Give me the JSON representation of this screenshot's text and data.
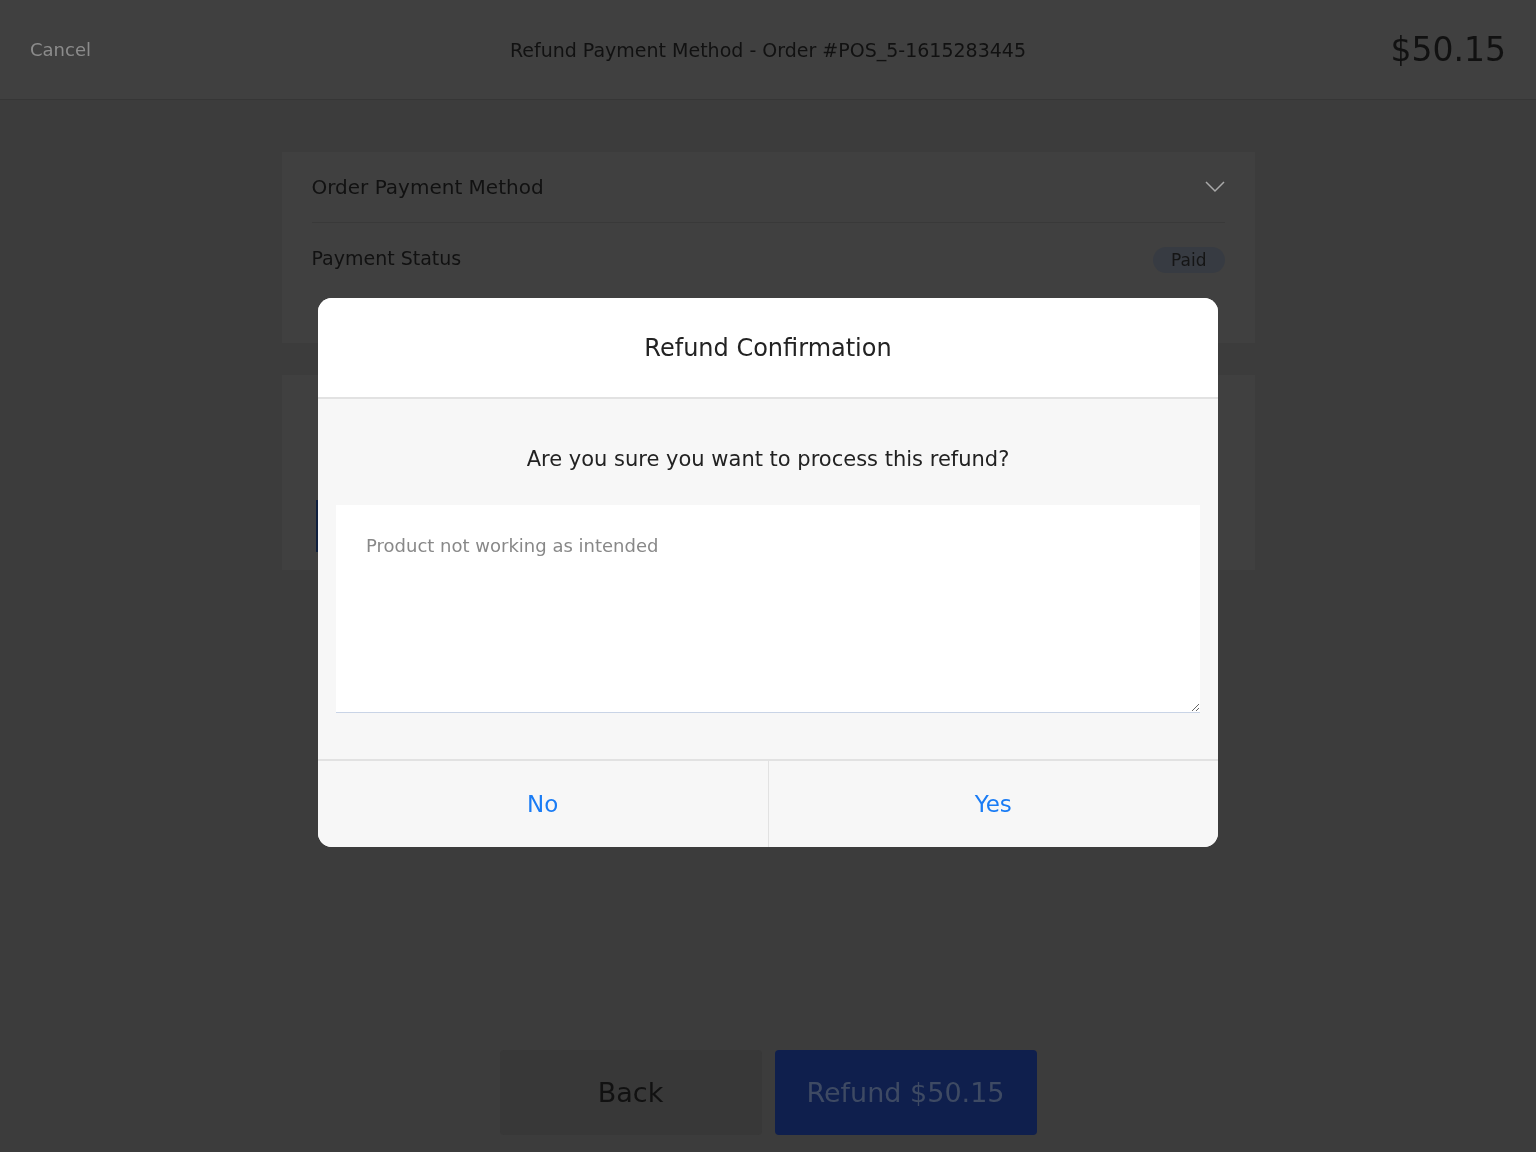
{
  "header": {
    "cancel": "Cancel",
    "title": "Refund Payment Method - Order #POS_5-1615283445",
    "total": "$50.15"
  },
  "payment_card": {
    "title": "Order Payment Method",
    "expanded": false,
    "status_label": "Payment Status",
    "status_badge": "Paid"
  },
  "footer_buttons": [
    {
      "label": "Back",
      "kind": "secondary"
    },
    {
      "label": "Refund $50.15",
      "kind": "primary"
    }
  ],
  "dialog": {
    "title": "Refund Confirmation",
    "message": "Are you sure you want to process this refund?",
    "reason": {
      "placeholder": "Product not working as intended"
    },
    "buttons": [
      "No",
      "Yes"
    ]
  }
}
